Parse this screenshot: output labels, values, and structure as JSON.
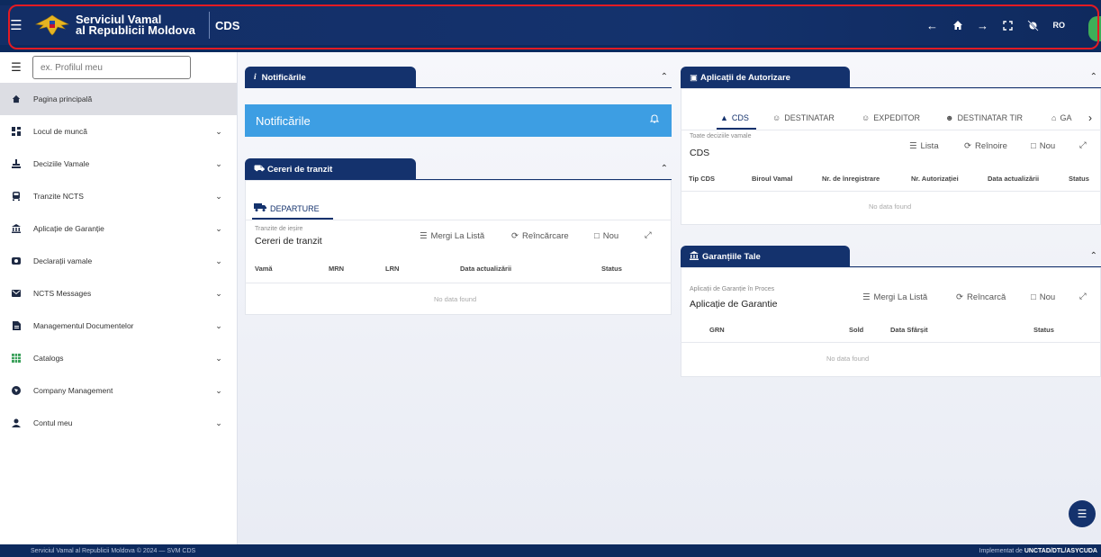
{
  "header": {
    "brand_line1": "Serviciul Vamal",
    "brand_line2": "al Republicii Moldova",
    "app_name": "CDS",
    "lang": "RO",
    "icons": [
      "menu-icon",
      "arrow-left-icon",
      "home-icon",
      "arrow-right-icon",
      "fullscreen-icon",
      "no-access-icon"
    ]
  },
  "sidebar": {
    "search_placeholder": "ex. Profilul meu",
    "items": [
      {
        "label": "Pagina principală",
        "icon": "home-icon"
      },
      {
        "label": "Locul de muncă",
        "icon": "dashboard-icon"
      },
      {
        "label": "Deciziile Vamale",
        "icon": "stamp-icon"
      },
      {
        "label": "Tranzite NCTS",
        "icon": "train-icon"
      },
      {
        "label": "Aplicație de Garanție",
        "icon": "bank-icon"
      },
      {
        "label": "Declarații vamale",
        "icon": "customs-icon"
      },
      {
        "label": "NCTS Messages",
        "icon": "mail-icon"
      },
      {
        "label": "Managementul Documentelor",
        "icon": "document-icon"
      },
      {
        "label": "Catalogs",
        "icon": "grid-icon"
      },
      {
        "label": "Company Management",
        "icon": "company-icon"
      },
      {
        "label": "Contul meu",
        "icon": "user-icon"
      }
    ]
  },
  "notif": {
    "tab": "Notificările",
    "box": "Notificările"
  },
  "transit": {
    "tab": "Cereri de tranzit",
    "subtab": "DEPARTURE",
    "small": "Tranzite de ieșire",
    "title": "Cereri de tranzit",
    "tools": [
      "Mergi La Listă",
      "Reîncărcare",
      "Nou"
    ],
    "columns": [
      "Vamă",
      "MRN",
      "LRN",
      "Data actualizării",
      "Status"
    ],
    "empty": "No data found"
  },
  "auth": {
    "tab": "Aplicații de Autorizare",
    "subtabs": [
      "CDS",
      "DESTINATAR",
      "EXPEDITOR",
      "DESTINATAR TIR",
      "GA"
    ],
    "small": "Toate deciziile vamale",
    "title": "CDS",
    "tools": [
      "Lista",
      "Reînoire",
      "Nou"
    ],
    "columns": [
      "Tip CDS",
      "Biroul Vamal",
      "Nr. de înregistrare",
      "Nr. Autorizației",
      "Data actualizării",
      "Status"
    ],
    "empty": "No data found"
  },
  "guarantee": {
    "tab": "Garanțiile Tale",
    "small": "Aplicații de Garanție în Proces",
    "title": "Aplicație de Garantie",
    "tools": [
      "Mergi La Listă",
      "Reîncarcă",
      "Nou"
    ],
    "columns": [
      "GRN",
      "Sold",
      "Data Sfârșit",
      "Status"
    ],
    "empty": "No data found"
  },
  "footer": {
    "left": "Serviciul Vamal al Republicii Moldova © 2024 — SVM CDS",
    "right_prefix": "Implementat de ",
    "right_bold": "UNCTAD/DTL/ASYCUDA"
  },
  "colors": {
    "primary": "#14326d",
    "notif": "#3d9ee3",
    "outline": "#e31b23"
  }
}
